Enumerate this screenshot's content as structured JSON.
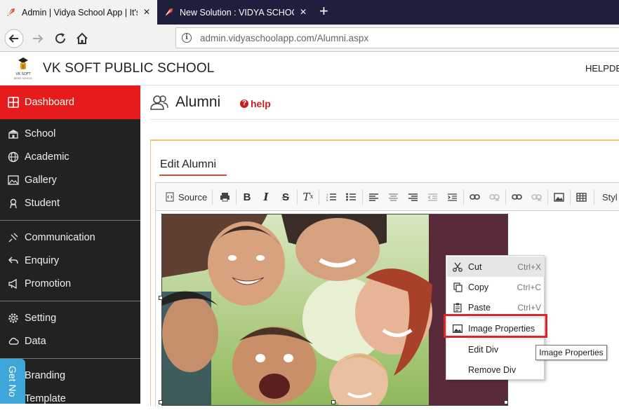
{
  "browser": {
    "tabs": [
      {
        "title": "Admin | Vidya School App | It's",
        "close": "×"
      },
      {
        "title": "New Solution : VIDYA SCHOOL",
        "close": "×"
      }
    ],
    "new_tab": "+",
    "url": "admin.vidyaschoolapp.com/Alumni.aspx"
  },
  "header": {
    "school_name": "VK SOFT PUBLIC SCHOOL",
    "helpdesk": "HELPDE"
  },
  "sidebar": {
    "items": [
      {
        "label": "Dashboard",
        "icon": "dashboard-icon"
      },
      {
        "label": "School",
        "icon": "school-icon"
      },
      {
        "label": "Academic",
        "icon": "globe-icon"
      },
      {
        "label": "Gallery",
        "icon": "image-icon"
      },
      {
        "label": "Student",
        "icon": "student-icon"
      },
      {
        "label": "Communication",
        "icon": "communication-icon"
      },
      {
        "label": "Enquiry",
        "icon": "reply-icon"
      },
      {
        "label": "Promotion",
        "icon": "megaphone-icon"
      },
      {
        "label": "Setting",
        "icon": "gear-icon"
      },
      {
        "label": "Data",
        "icon": "cloud-icon"
      },
      {
        "label": "Branding",
        "icon": "branding-icon"
      },
      {
        "label": "Template",
        "icon": "template-icon"
      }
    ],
    "get_now": "Get No"
  },
  "page": {
    "title": "Alumni",
    "help": "help",
    "edit_title": "Edit Alumni"
  },
  "editor": {
    "source_label": "Source",
    "styles_label": "Styl"
  },
  "context_menu": {
    "items": [
      {
        "label": "Cut",
        "shortcut": "Ctrl+X",
        "icon": "scissors-icon"
      },
      {
        "label": "Copy",
        "shortcut": "Ctrl+C",
        "icon": "copy-icon"
      },
      {
        "label": "Paste",
        "shortcut": "Ctrl+V",
        "icon": "paste-icon"
      },
      {
        "label": "Image Properties",
        "shortcut": "",
        "icon": "image-icon"
      },
      {
        "label": "Edit Div",
        "shortcut": "",
        "icon": ""
      },
      {
        "label": "Remove Div",
        "shortcut": "",
        "icon": ""
      }
    ]
  },
  "tooltip": "Image Properties",
  "colors": {
    "sidebar_bg": "#222222",
    "active_red": "#e61b1b",
    "tabbar": "#1d1f3c",
    "highlight_box": "#e0222a"
  }
}
